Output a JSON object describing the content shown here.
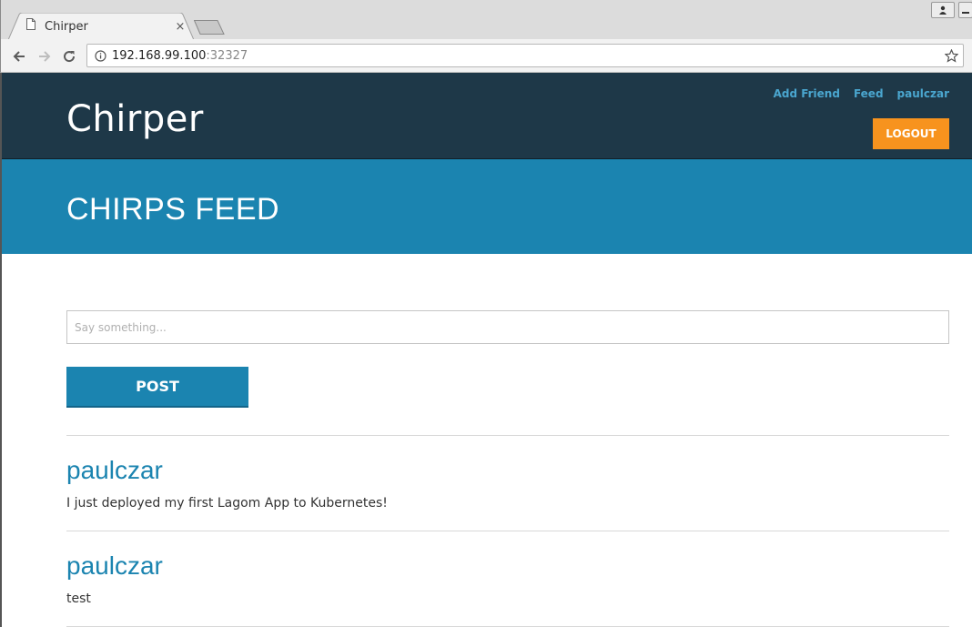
{
  "browser": {
    "tab_title": "Chirper",
    "tab_close": "×",
    "url_host": "192.168.99.100",
    "url_port": ":32327"
  },
  "header": {
    "brand": "Chirper",
    "nav": [
      "Add Friend",
      "Feed",
      "paulczar"
    ],
    "logout_label": "LOGOUT"
  },
  "hero": {
    "title": "CHIRPS FEED"
  },
  "composer": {
    "placeholder": "Say something...",
    "value": ""
  },
  "post_button": {
    "label": "POST"
  },
  "chirps": [
    {
      "user": "paulczar",
      "text": "I just deployed my first Lagom App to Kubernetes!"
    },
    {
      "user": "paulczar",
      "text": "test"
    }
  ],
  "colors": {
    "header_bg": "#1e3848",
    "hero_bg": "#1b84b0",
    "accent_orange": "#f7931e",
    "link_blue": "#4aa6cf"
  }
}
